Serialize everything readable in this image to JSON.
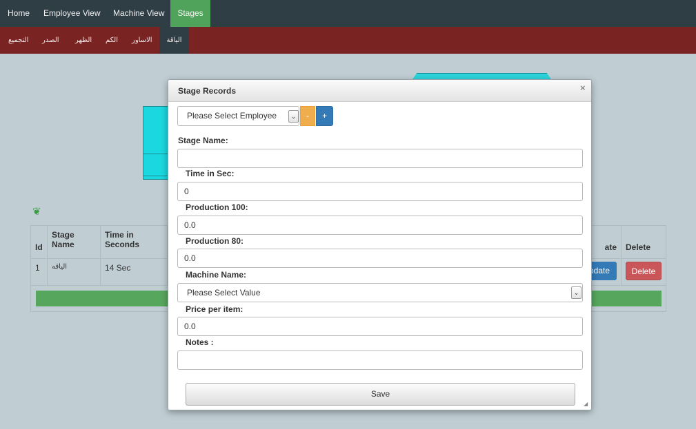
{
  "topnav": {
    "items": [
      {
        "label": "Home"
      },
      {
        "label": "Employee View"
      },
      {
        "label": "Machine View"
      },
      {
        "label": "Stages"
      }
    ]
  },
  "subnav": {
    "items": [
      {
        "label": "التجميع"
      },
      {
        "label": "الصدر"
      },
      {
        "label": "الظهر"
      },
      {
        "label": "الكم"
      },
      {
        "label": "الاساور"
      },
      {
        "label": "الياقة"
      }
    ]
  },
  "table": {
    "headers": [
      "Id",
      "Stage Name",
      "Time in Seconds",
      "Update",
      "Delete"
    ],
    "header_visible": {
      "stage_name_line1": "Stage",
      "stage_name_line2": "Name",
      "time_line1": "Time in",
      "time_line2": "Seconds",
      "update_partial": "ate"
    },
    "rows": [
      {
        "id": "1",
        "stage_name": "الياقه",
        "time": "14 Sec",
        "update_label": "pdate",
        "delete_label": "Delete"
      }
    ]
  },
  "modal": {
    "title": "Stage Records",
    "close_glyph": "×",
    "employee_select": {
      "value": "Please Select Employee",
      "arrow": "⌄"
    },
    "minus_label": "-",
    "plus_label": "+",
    "fields": {
      "stage_name": {
        "label": "Stage Name:",
        "value": ""
      },
      "time_in_sec": {
        "label": "Time in Sec:",
        "value": "0"
      },
      "production_100": {
        "label": "Production 100:",
        "value": "0.0"
      },
      "production_80": {
        "label": "Production 80:",
        "value": "0.0"
      },
      "machine_name": {
        "label": "Machine Name:",
        "value": "Please Select Value",
        "arrow": "⌄"
      },
      "price_per_item": {
        "label": "Price per item:",
        "value": "0.0"
      },
      "notes": {
        "label": "Notes :",
        "value": ""
      }
    },
    "save_label": "Save"
  },
  "colors": {
    "topnav_bg": "#2f3d45",
    "active_green": "#4fa35b",
    "subnav_bg": "#7a2323",
    "page_bg": "#c0ced4",
    "primary_blue": "#337ab7",
    "warning_orange": "#f0ad4e",
    "danger_red": "#c9575a"
  }
}
